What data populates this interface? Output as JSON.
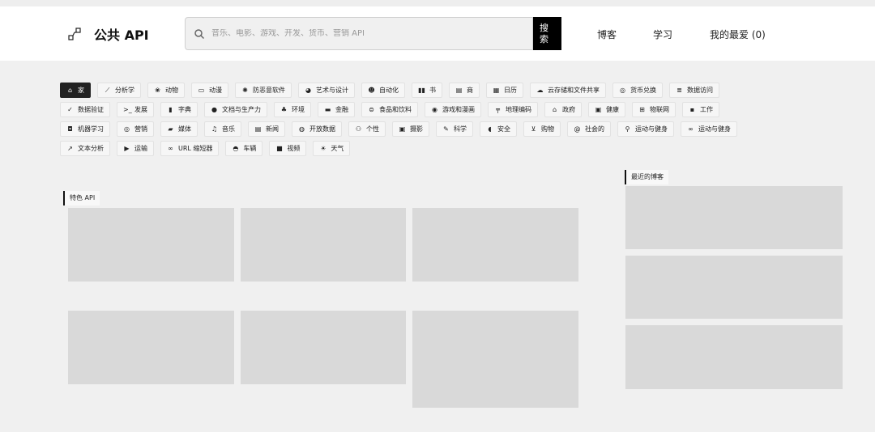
{
  "header": {
    "logo_title": "公共 API",
    "search": {
      "placeholder": "音乐、电影、游戏、开发、货币、营销 API",
      "value": ""
    },
    "search_button": "搜索",
    "nav": {
      "blog": "博客",
      "learn": "学习",
      "favorites": "我的最爱 (0)"
    }
  },
  "categories": [
    [
      {
        "icon": "home-icon",
        "glyph": "⌂",
        "label": "家",
        "active": true
      },
      {
        "icon": "chart-icon",
        "glyph": "⟋",
        "label": "分析学"
      },
      {
        "icon": "paw-icon",
        "glyph": "❀",
        "label": "动物"
      },
      {
        "icon": "monitor-icon",
        "glyph": "▭",
        "label": "动漫"
      },
      {
        "icon": "virus-icon",
        "glyph": "✺",
        "label": "防恶意软件"
      },
      {
        "icon": "palette-icon",
        "glyph": "◕",
        "label": "艺术与设计"
      },
      {
        "icon": "robot-icon",
        "glyph": "☻",
        "label": "自动化"
      },
      {
        "icon": "book-icon",
        "glyph": "▮▮",
        "label": "书"
      },
      {
        "icon": "store-icon",
        "glyph": "▤",
        "label": "商"
      },
      {
        "icon": "calendar-icon",
        "glyph": "▦",
        "label": "日历"
      },
      {
        "icon": "cloud-upload-icon",
        "glyph": "☁",
        "label": "云存储和文件共享"
      },
      {
        "icon": "coins-icon",
        "glyph": "◎",
        "label": "货币兑换"
      },
      {
        "icon": "database-icon",
        "glyph": "≣",
        "label": "数据访问"
      }
    ],
    [
      {
        "icon": "check-icon",
        "glyph": "✓",
        "label": "数据验证"
      },
      {
        "icon": "terminal-icon",
        "glyph": ">_",
        "label": "发展"
      },
      {
        "icon": "dictionary-icon",
        "glyph": "▮",
        "label": "字典"
      },
      {
        "icon": "check-circle-icon",
        "glyph": "●",
        "label": "文档与生产力"
      },
      {
        "icon": "plant-icon",
        "glyph": "♣",
        "label": "环境"
      },
      {
        "icon": "wallet-icon",
        "glyph": "▬",
        "label": "金融"
      },
      {
        "icon": "food-icon",
        "glyph": "⊜",
        "label": "食品和饮料"
      },
      {
        "icon": "gamepad-icon",
        "glyph": "◉",
        "label": "游戏和漫画"
      },
      {
        "icon": "map-sign-icon",
        "glyph": "╤",
        "label": "地理编码"
      },
      {
        "icon": "government-icon",
        "glyph": "⌂",
        "label": "政府"
      },
      {
        "icon": "health-icon",
        "glyph": "▣",
        "label": "健康"
      },
      {
        "icon": "network-icon",
        "glyph": "⊞",
        "label": "物联网"
      },
      {
        "icon": "briefcase-icon",
        "glyph": "▪",
        "label": "工作"
      }
    ],
    [
      {
        "icon": "robot-head-icon",
        "glyph": "◘",
        "label": "机器学习"
      },
      {
        "icon": "target-icon",
        "glyph": "◎",
        "label": "营销"
      },
      {
        "icon": "folder-icon",
        "glyph": "▰",
        "label": "媒体"
      },
      {
        "icon": "music-icon",
        "glyph": "♫",
        "label": "音乐"
      },
      {
        "icon": "newspaper-icon",
        "glyph": "▤",
        "label": "新闻"
      },
      {
        "icon": "globe-icon",
        "glyph": "◍",
        "label": "开放数据"
      },
      {
        "icon": "people-icon",
        "glyph": "⚇",
        "label": "个性"
      },
      {
        "icon": "image-icon",
        "glyph": "▣",
        "label": "摄影"
      },
      {
        "icon": "pen-icon",
        "glyph": "✎",
        "label": "科学"
      },
      {
        "icon": "shield-icon",
        "glyph": "◖",
        "label": "安全"
      },
      {
        "icon": "cart-icon",
        "glyph": "⊻",
        "label": "购物"
      },
      {
        "icon": "at-icon",
        "glyph": "@",
        "label": "社会的"
      },
      {
        "icon": "running-icon",
        "glyph": "⚲",
        "label": "运动与健身"
      },
      {
        "icon": "bicycle-icon",
        "glyph": "∞",
        "label": "运动与健身"
      }
    ],
    [
      {
        "icon": "trend-icon",
        "glyph": "↗",
        "label": "文本分析"
      },
      {
        "icon": "truck-icon",
        "glyph": "▶",
        "label": "运输"
      },
      {
        "icon": "link-icon",
        "glyph": "∞",
        "label": "URL 缩短器"
      },
      {
        "icon": "car-icon",
        "glyph": "◓",
        "label": "车辆"
      },
      {
        "icon": "video-icon",
        "glyph": "■",
        "label": "视频"
      },
      {
        "icon": "cloud-sun-icon",
        "glyph": "☀",
        "label": "天气"
      }
    ]
  ],
  "featured": {
    "label": "特色 API"
  },
  "recent": {
    "label": "最近的博客"
  }
}
